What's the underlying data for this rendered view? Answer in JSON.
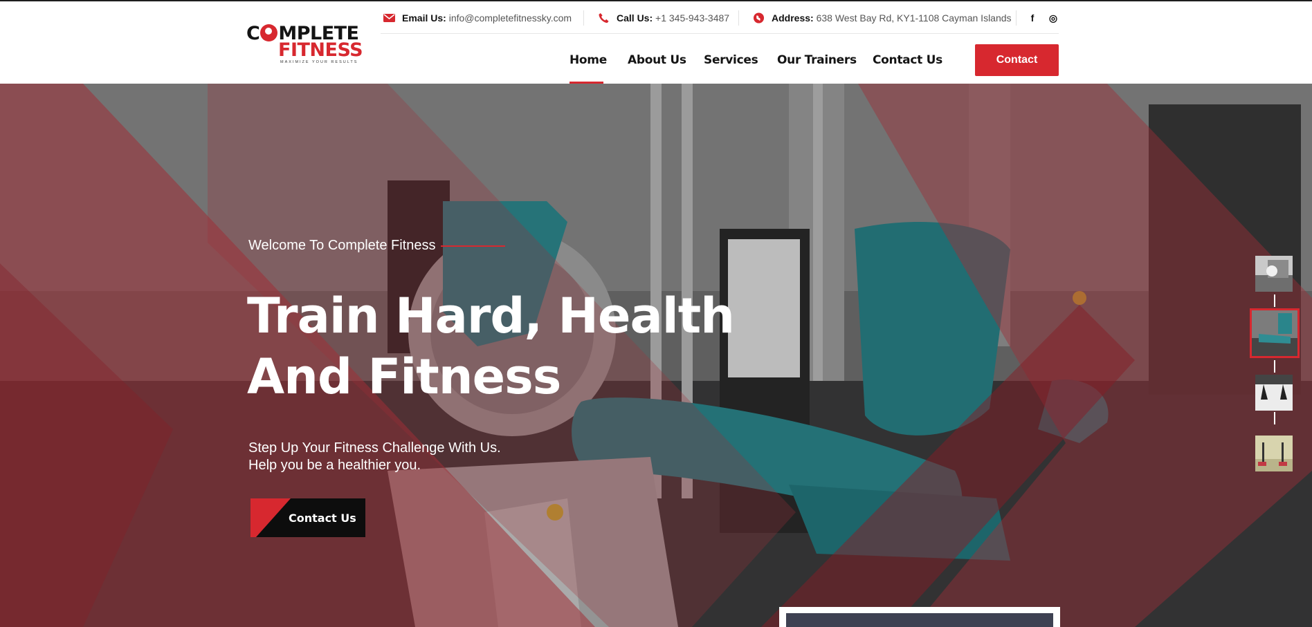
{
  "brand": {
    "logo_line1_a": "C",
    "logo_line1_b": "MPLETE",
    "logo_line2": "FITNESS",
    "logo_tagline": "MAXIMIZE YOUR RESULTS"
  },
  "topbar": {
    "email_label": "Email Us:",
    "email_value": "info@completefitnessky.com",
    "phone_label": "Call Us:",
    "phone_value": "+1 345-943-3487",
    "address_label": "Address:",
    "address_value": "638 West Bay Rd, KY1-1108 Cayman Islands",
    "facebook_glyph": "f",
    "instagram_glyph": "◎"
  },
  "nav": {
    "items": [
      "Home",
      "About Us",
      "Services",
      "Our Trainers",
      "Contact Us"
    ],
    "active": "Home",
    "contact_button": "Contact"
  },
  "hero": {
    "eyebrow": "Welcome To Complete Fitness",
    "title_line1": "Train Hard, Health",
    "title_line2": "And Fitness",
    "subtitle_line1": "Step Up Your Fitness Challenge With Us.",
    "subtitle_line2": "Help you be a healthier you.",
    "cta_label": "Contact Us",
    "slide_count": 4,
    "active_slide": 2
  },
  "colors": {
    "accent": "#d7282f",
    "dark": "#141414",
    "overlay_red": "#c23a44",
    "seat_teal": "#2f8d93"
  },
  "icons": {
    "email": "envelope-icon",
    "phone": "phone-icon",
    "address": "location-pin-icon",
    "facebook": "facebook-icon",
    "instagram": "instagram-icon"
  }
}
